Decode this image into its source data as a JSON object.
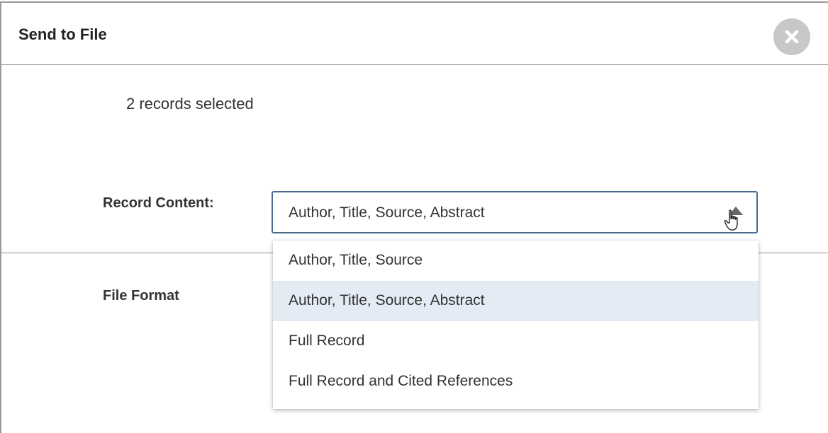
{
  "dialog": {
    "title": "Send to File",
    "close_icon": "close-icon"
  },
  "records_selected": "2 records selected",
  "record_content": {
    "label": "Record Content:",
    "selected_value": "Author, Title, Source, Abstract",
    "dropdown_open": true,
    "options": [
      "Author, Title, Source",
      "Author, Title, Source, Abstract",
      "Full Record",
      "Full Record and Cited References"
    ],
    "highlighted_index": 1,
    "highlight_color": "#e3ebf4",
    "focus_border_color": "#4a6d8f"
  },
  "file_format": {
    "label": "File Format"
  }
}
